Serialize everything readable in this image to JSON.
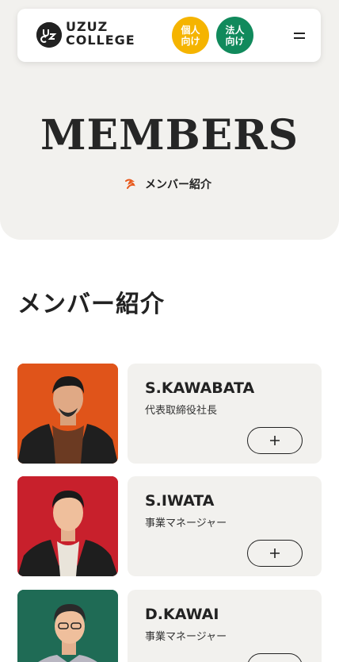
{
  "header": {
    "logo_line1": "UZUZ",
    "logo_line2": "COLLEGE",
    "logo_mark_text": "uzc",
    "individual_label_line1": "個人",
    "individual_label_line2": "向け",
    "corporate_label_line1": "法人",
    "corporate_label_line2": "向け",
    "menu_icon": "hamburger-icon"
  },
  "hero": {
    "title": "MEMBERS",
    "breadcrumb_icon": "uzuz-swirl-icon",
    "breadcrumb_current": "メンバー紹介"
  },
  "section": {
    "title": "メンバー紹介"
  },
  "members": [
    {
      "name": "S.KAWABATA",
      "role": "代表取締役社長",
      "photo_bg": "#e0541a",
      "expand_icon": "plus-icon"
    },
    {
      "name": "S.IWATA",
      "role": "事業マネージャー",
      "photo_bg": "#c8202c",
      "expand_icon": "plus-icon"
    },
    {
      "name": "D.KAWAI",
      "role": "事業マネージャー",
      "photo_bg": "#1f6b55",
      "expand_icon": "plus-icon"
    }
  ],
  "colors": {
    "individual": "#f5b400",
    "corporate": "#118a5c",
    "accent_orange": "#e8591c",
    "hero_bg": "#f2f1ee"
  }
}
